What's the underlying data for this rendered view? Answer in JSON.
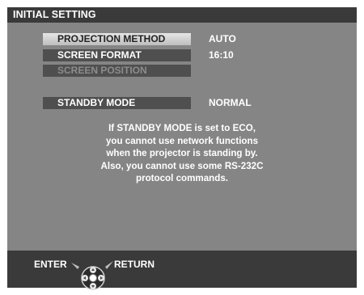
{
  "title": "INITIAL SETTING",
  "menu": [
    {
      "label": "PROJECTION METHOD",
      "value": "AUTO"
    },
    {
      "label": "SCREEN FORMAT",
      "value": "16:10"
    },
    {
      "label": "SCREEN POSITION",
      "value": ""
    },
    {
      "label": "STANDBY MODE",
      "value": "NORMAL"
    }
  ],
  "message": [
    "If STANDBY MODE is set to ECO,",
    "you cannot use network functions",
    "when the projector is standing by.",
    "Also, you cannot use some RS-232C",
    "protocol commands."
  ],
  "footer": {
    "enter_label": "ENTER",
    "return_label": "RETURN"
  },
  "icons": {
    "dpad": "dpad-icon"
  },
  "colors": {
    "title_bar": "#3a3a3a",
    "panel": "#858585",
    "menu_item": "#4f4f4f",
    "menu_selected": "#d9d9d9"
  }
}
